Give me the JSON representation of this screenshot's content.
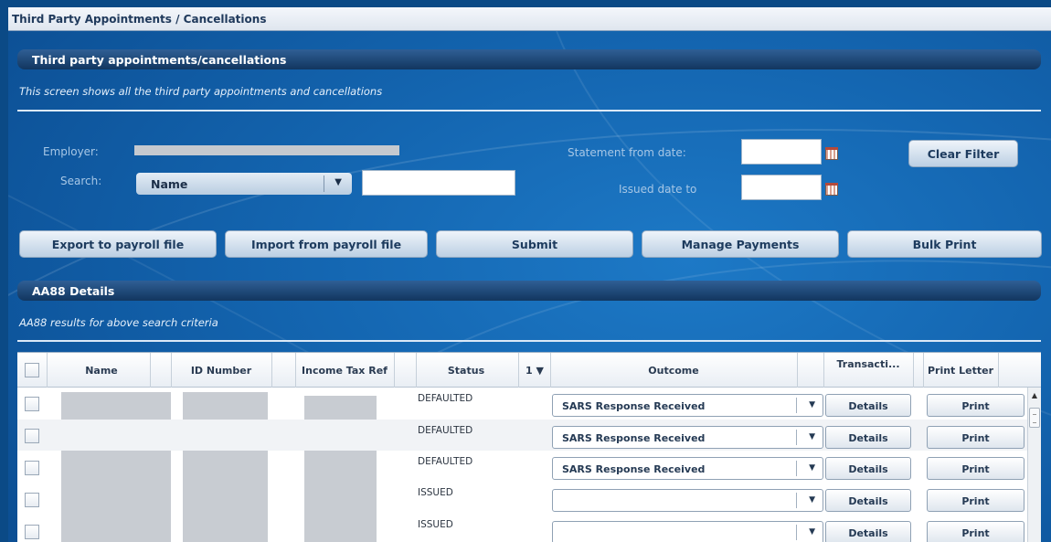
{
  "window": {
    "title": "Third Party Appointments / Cancellations"
  },
  "section_main": {
    "title": "Third party appointments/cancellations",
    "description": "This screen shows all the third party appointments and cancellations"
  },
  "filters": {
    "employer_label": "Employer:",
    "search_label": "Search:",
    "search_select_value": "Name",
    "statement_from_label": "Statement from date:",
    "issued_to_label": "Issued date to",
    "clear_filter": "Clear Filter"
  },
  "actions": {
    "export": "Export to payroll file",
    "import": "Import from payroll file",
    "submit": "Submit",
    "manage_payments": "Manage Payments",
    "bulk_print": "Bulk Print"
  },
  "section_details": {
    "title": "AA88 Details",
    "description": "AA88 results for above search criteria"
  },
  "grid": {
    "columns": {
      "name": "Name",
      "id_number": "ID Number",
      "income_tax_ref": "Income Tax Ref",
      "status": "Status",
      "sort_indicator": "1 ▼",
      "outcome": "Outcome",
      "transaction": "Transacti...",
      "print_letter": "Print Letter"
    },
    "rows": [
      {
        "status": "DEFAULTED",
        "outcome": "SARS Response Received",
        "details": "Details",
        "print": "Print"
      },
      {
        "status": "DEFAULTED",
        "outcome": "SARS Response Received",
        "details": "Details",
        "print": "Print"
      },
      {
        "status": "DEFAULTED",
        "outcome": "SARS Response Received",
        "details": "Details",
        "print": "Print"
      },
      {
        "status": "ISSUED",
        "outcome": "",
        "details": "Details",
        "print": "Print"
      },
      {
        "status": "ISSUED",
        "outcome": "",
        "details": "Details",
        "print": "Print"
      }
    ]
  },
  "icons": {
    "dropdown": "chevron-down-icon",
    "calendar": "calendar-icon",
    "scroll_up": "scroll-up-icon"
  }
}
